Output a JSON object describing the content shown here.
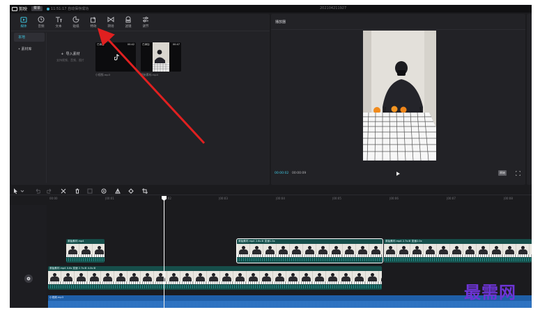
{
  "window": {
    "app_name": "剪映",
    "menu_label": "菜单",
    "save_status": "11:51:17 自动保存成功",
    "project_title": "202104211927"
  },
  "toolbar": {
    "tabs": [
      {
        "label": "媒体",
        "icon": "media-icon",
        "active": true
      },
      {
        "label": "音频",
        "icon": "audio-icon",
        "active": false
      },
      {
        "label": "文本",
        "icon": "text-icon",
        "active": false
      },
      {
        "label": "贴纸",
        "icon": "sticker-icon",
        "active": false
      },
      {
        "label": "特效",
        "icon": "effects-icon",
        "active": false
      },
      {
        "label": "转场",
        "icon": "transition-icon",
        "active": false
      },
      {
        "label": "滤镜",
        "icon": "filter-icon",
        "active": false
      },
      {
        "label": "调节",
        "icon": "adjust-icon",
        "active": false
      }
    ]
  },
  "media": {
    "side_nav": [
      {
        "label": "本地",
        "active": true
      },
      {
        "label": "• 素材库",
        "active": false
      }
    ],
    "import_label": "导入素材",
    "import_hint": "支持视频、音频、图片",
    "clips": [
      {
        "badge": "已添加",
        "duration": "00:42",
        "name": "小视频.mp3"
      },
      {
        "badge": "已添加",
        "duration": "00:47",
        "name": "原始素材.mp4"
      }
    ]
  },
  "player": {
    "title": "播放器",
    "current_time": "00:00:02",
    "total_time": "00:00:09",
    "ratio_label": "原始",
    "colors": {
      "accent": "#3fc6e0"
    }
  },
  "timeline": {
    "ruler_labels": [
      "00:00",
      "|00:01",
      "|00:02",
      "|00:03",
      "|00:04",
      "|00:05",
      "|00:06",
      "|00:07",
      "|00:08"
    ],
    "track1": [
      {
        "label": "原始素材.mp4"
      },
      {
        "label": "原始素材.mp4  2.6s  ⊞ 变速1.0x"
      },
      {
        "label": "原始素材.mp4  2.7s  ⊞ 变速2.0x"
      }
    ],
    "track2": [
      {
        "label": "原始素材.mp4  0.6s  变速  2.7s  ⊞  4.0s  ⊞"
      }
    ],
    "audio": {
      "label": "小视频.mp3"
    }
  },
  "watermark": "最需网",
  "colors": {
    "arrow": "#e02020",
    "watermark": "#6d34d6"
  }
}
